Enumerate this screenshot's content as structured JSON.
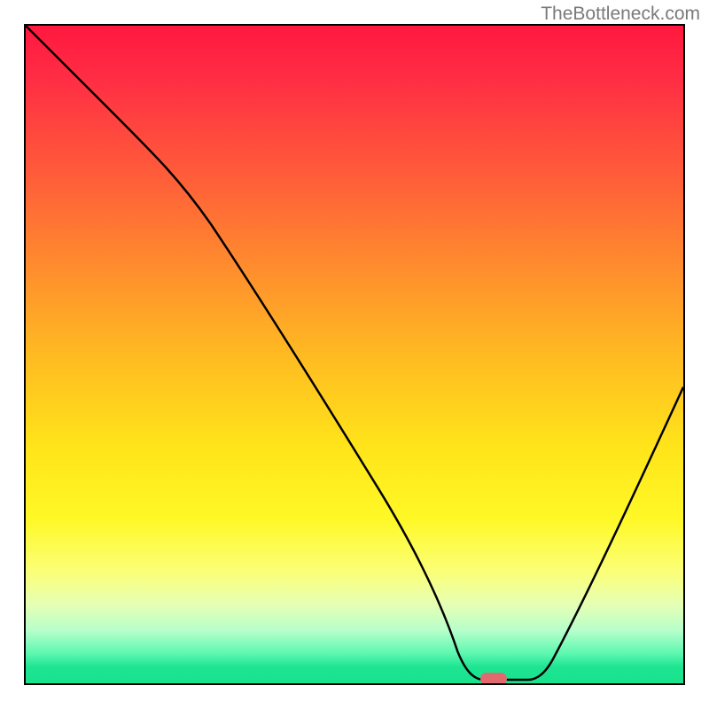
{
  "watermark": "TheBottleneck.com",
  "chart_data": {
    "type": "line",
    "title": "",
    "xlabel": "",
    "ylabel": "",
    "xlim": [
      0,
      100
    ],
    "ylim": [
      0,
      100
    ],
    "grid": false,
    "series": [
      {
        "name": "curve",
        "x": [
          0,
          12,
          23,
          30,
          40,
          50,
          58,
          63,
          67,
          73,
          78,
          85,
          92,
          100
        ],
        "values": [
          100,
          88,
          76,
          70,
          55,
          40,
          25,
          12,
          3,
          0,
          0,
          12,
          30,
          55
        ]
      }
    ],
    "marker": {
      "x": 70,
      "y": 0
    },
    "gradient_stops": [
      {
        "pos": 0,
        "color": "#ff183f"
      },
      {
        "pos": 0.5,
        "color": "#ffba22"
      },
      {
        "pos": 0.75,
        "color": "#fff826"
      },
      {
        "pos": 1.0,
        "color": "#19e28d"
      }
    ]
  }
}
